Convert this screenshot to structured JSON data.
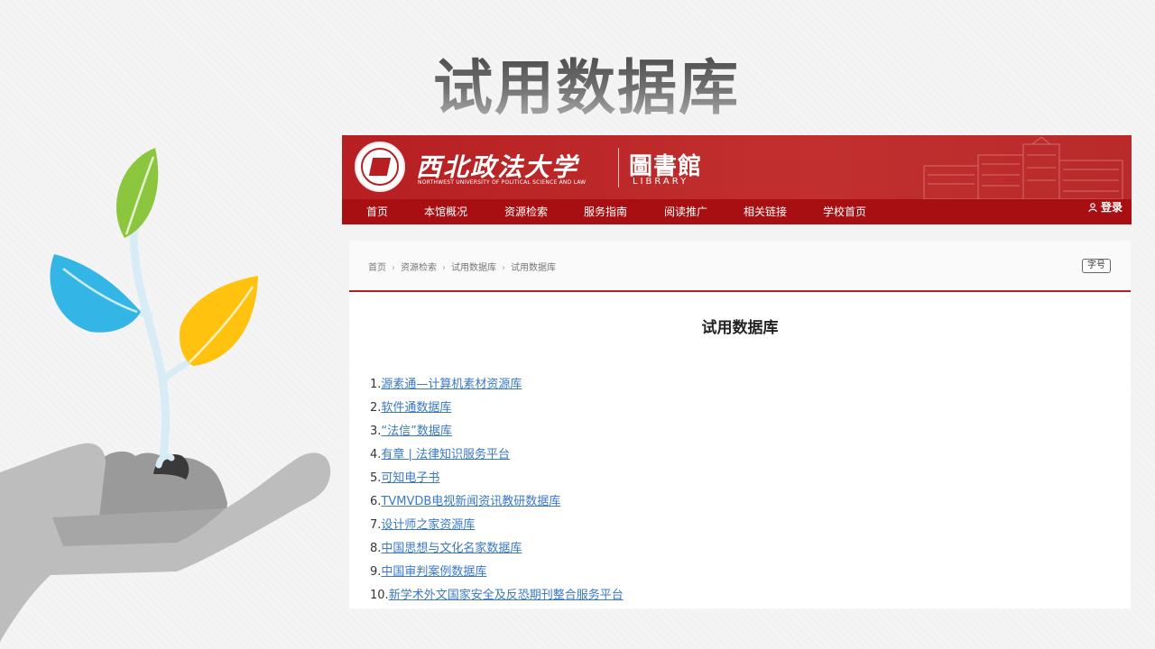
{
  "slide": {
    "title": "试用数据库"
  },
  "header": {
    "school_name": "西北政法大学",
    "school_name_en": "NORTHWEST UNIVERSITY OF POLITICAL SCIENCE AND LAW",
    "library_name": "圖書館",
    "library_name_en": "LIBRARY"
  },
  "nav": {
    "items": [
      {
        "label": "首页"
      },
      {
        "label": "本馆概况"
      },
      {
        "label": "资源检索"
      },
      {
        "label": "服务指南"
      },
      {
        "label": "阅读推广"
      },
      {
        "label": "相关链接"
      },
      {
        "label": "学校首页"
      }
    ],
    "login_label": "登录"
  },
  "breadcrumb": [
    "首页",
    "资源检索",
    "试用数据库",
    "试用数据库"
  ],
  "font_size_button": "字号",
  "page": {
    "heading": "试用数据库",
    "databases": [
      {
        "num": "1.",
        "name": "源素通—计算机素材资源库"
      },
      {
        "num": "2.",
        "name": "软件通数据库"
      },
      {
        "num": "3.",
        "name": "“法信”数据库"
      },
      {
        "num": "4.",
        "name": "有章 | 法律知识服务平台"
      },
      {
        "num": "5.",
        "name": "可知电子书"
      },
      {
        "num": "6.",
        "name": "TVMVDB电视新闻资讯教研数据库"
      },
      {
        "num": "7.",
        "name": "设计师之家资源库"
      },
      {
        "num": "8.",
        "name": "中国思想与文化名家数据库"
      },
      {
        "num": "9.",
        "name": "中国审判案例数据库"
      },
      {
        "num": "10.",
        "name": "新学术外文国家安全及反恐期刊整合服务平台"
      }
    ]
  },
  "colors": {
    "header_red": "#b71f22",
    "nav_red": "#a80f12",
    "link_blue": "#3a78c6",
    "leaf_green": "#8cc63f",
    "leaf_blue": "#33b5e5",
    "leaf_yellow": "#ffc20e",
    "hand_gray": "#bdbdbd"
  }
}
